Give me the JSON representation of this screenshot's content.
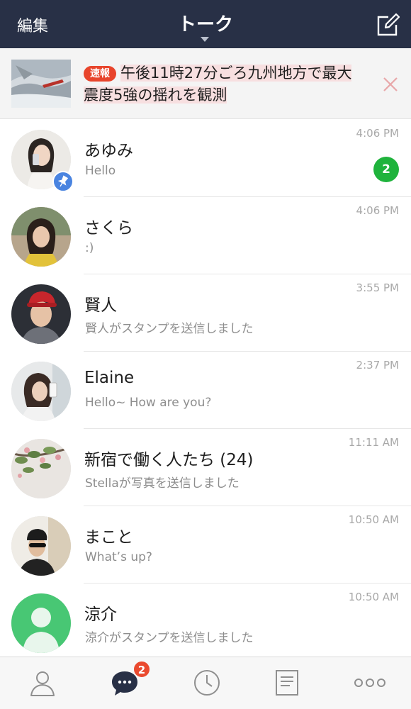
{
  "header": {
    "edit_label": "編集",
    "title": "トーク"
  },
  "news": {
    "badge": "速報",
    "headline": "午後11時27分ごろ九州地方で最大震度5強の揺れを観測"
  },
  "chats": [
    {
      "name": "あゆみ",
      "message": "Hello",
      "time": "4:06 PM",
      "unread": "2",
      "pinned": true
    },
    {
      "name": "さくら",
      "message": ":)",
      "time": "4:06 PM"
    },
    {
      "name": "賢人",
      "message": "賢人がスタンプを送信しました",
      "time": "3:55 PM"
    },
    {
      "name": "Elaine",
      "message": "Hello~ How are you?",
      "time": "2:37 PM"
    },
    {
      "name": "新宿で働く人たち (24)",
      "message": "Stellaが写真を送信しました",
      "time": "11:11 AM"
    },
    {
      "name": "まこと",
      "message": "What’s up?",
      "time": "10:50 AM"
    },
    {
      "name": "涼介",
      "message": "涼介がスタンプを送信しました",
      "time": "10:50 AM"
    }
  ],
  "tabbar": {
    "chats_badge": "2"
  },
  "colors": {
    "header_bg": "#283046",
    "unread_green": "#1fb33c",
    "badge_red": "#ea4a2f",
    "pin_blue": "#4a84e0"
  },
  "icons": {
    "compose": "compose-icon",
    "close": "close-icon",
    "pin": "pin-icon",
    "friends": "person-icon",
    "chats": "chat-bubble-icon",
    "timeline": "clock-icon",
    "news": "document-icon",
    "more": "more-icon"
  }
}
